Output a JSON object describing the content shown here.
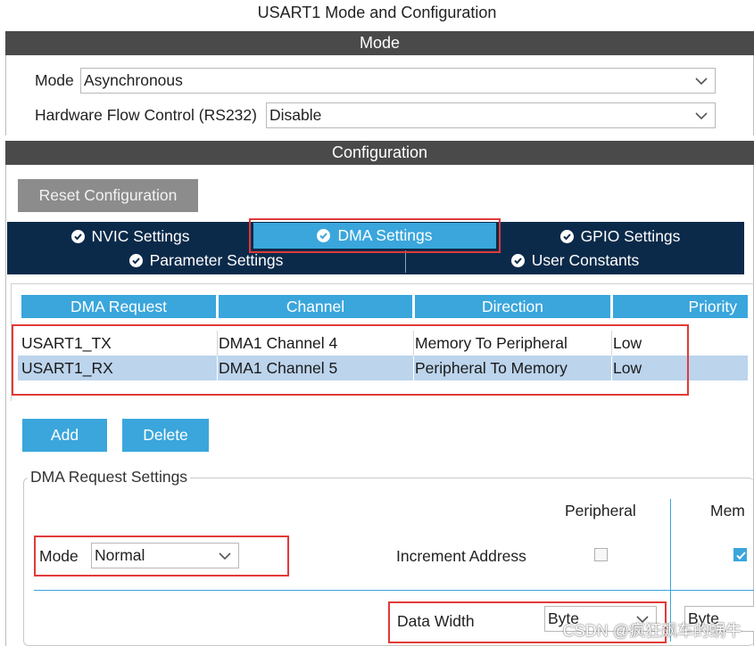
{
  "window": {
    "title": "USART1 Mode and Configuration"
  },
  "mode_section": {
    "header": "Mode",
    "mode": {
      "label": "Mode",
      "value": "Asynchronous"
    },
    "flow_control": {
      "label": "Hardware Flow Control (RS232)",
      "value": "Disable"
    }
  },
  "config_section": {
    "header": "Configuration",
    "reset_label": "Reset Configuration",
    "tabs": [
      {
        "label": "NVIC Settings",
        "active": false
      },
      {
        "label": "DMA Settings",
        "active": true
      },
      {
        "label": "GPIO Settings",
        "active": false
      },
      {
        "label": "Parameter Settings",
        "active": false
      },
      {
        "label": "User Constants",
        "active": false
      }
    ]
  },
  "dma_table": {
    "columns": [
      "DMA Request",
      "Channel",
      "Direction",
      "Priority"
    ],
    "rows": [
      {
        "request": "USART1_TX",
        "channel": "DMA1 Channel 4",
        "direction": "Memory To Peripheral",
        "priority": "Low",
        "selected": false
      },
      {
        "request": "USART1_RX",
        "channel": "DMA1 Channel 5",
        "direction": "Peripheral To Memory",
        "priority": "Low",
        "selected": true
      }
    ]
  },
  "actions": {
    "add_label": "Add",
    "delete_label": "Delete"
  },
  "request_settings": {
    "legend": "DMA Request Settings",
    "peripheral_header": "Peripheral",
    "memory_header": "Mem",
    "mode": {
      "label": "Mode",
      "value": "Normal"
    },
    "increment_address_label": "Increment Address",
    "peripheral_increment_checked": false,
    "memory_increment_checked": true,
    "data_width_label": "Data Width",
    "peripheral_data_width": "Byte",
    "memory_data_width": "Byte"
  },
  "watermark": "CSDN @疯狂飙车的蜗牛",
  "colors": {
    "accent": "#3aa6dc",
    "tab_bar": "#0b2a4a",
    "section_header": "#4a4a4a",
    "highlight_box": "#e03a3a",
    "selected_row": "#bcd4ec"
  }
}
